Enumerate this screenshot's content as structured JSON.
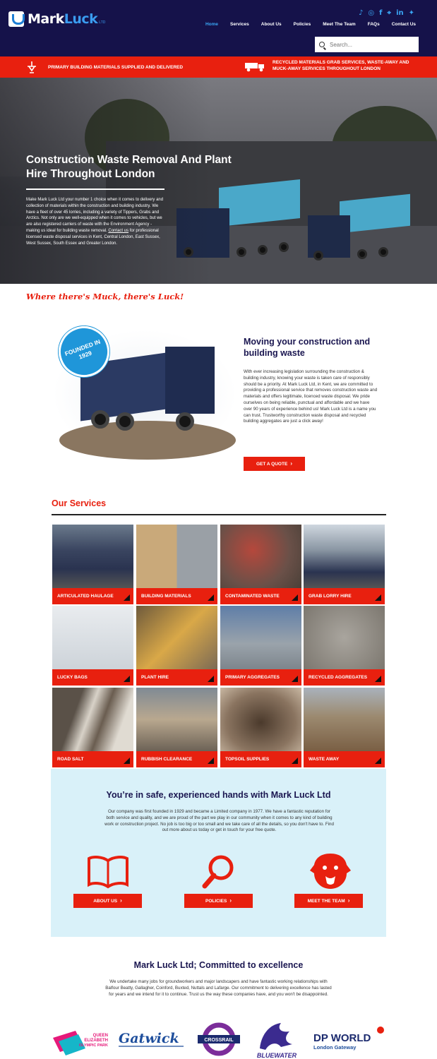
{
  "header": {
    "logo_part1": "Mark",
    "logo_part2": "Luck",
    "logo_ltd": "LTD",
    "social_icons": [
      "tiktok-icon",
      "instagram-icon",
      "facebook-icon",
      "location-icon",
      "linkedin-icon",
      "twitter-icon"
    ],
    "nav": [
      "Home",
      "Services",
      "About Us",
      "Policies",
      "Meet The Team",
      "FAQs",
      "Contact Us"
    ],
    "search_placeholder": "Search..."
  },
  "redbar": {
    "left": "PRIMARY BUILDING MATERIALS SUPPLIED AND DELIVERED",
    "right": "RECYCLED MATERIALS GRAB SERVICES, WASTE-AWAY AND MUCK-AWAY SERVICES THROUGHOUT LONDON"
  },
  "hero": {
    "title": "Construction Waste Removal And Plant Hire Throughout London",
    "text_before_link": "Make Mark Luck Ltd your number 1 choice when it comes to delivery and collection of materials within the construction and building industry. We have a fleet of over 45 lorries, including a variety of Tippers, Grabs and Arctics. Not only are we well-equipped when it comes to vehicles, but we are also registered carriers of waste with the Environment Agency - making us ideal for building waste removal. ",
    "link": "Contact us",
    "text_after_link": " for professional licensed waste disposal services in Kent, Central London, East Sussex, West Sussex, South Essex and Greater London."
  },
  "tagline": "Where there's Muck, there's Luck!",
  "intro": {
    "badge": "FOUNDED IN 1929",
    "heading": "Moving your construction and building waste",
    "text": "With ever increasing legislation surrounding the construction & building industry, knowing your waste is taken care of responsibly should be a priority. At Mark Luck Ltd, in Kent, we are committed to providing a professional service that removes construction waste and materials and offers legitimate, licenced waste disposal. We pride ourselves on being reliable, punctual and affordable and we have over 90 years of experience behind us! Mark Luck Ltd is a name you can trust. Trustworthy construction waste disposal and recycled building aggregates are just a click away!",
    "button": "GET A QUOTE"
  },
  "services": {
    "title": "Our Services",
    "items": [
      {
        "label": "ARTICULATED HAULAGE"
      },
      {
        "label": "BUILDING MATERIALS"
      },
      {
        "label": "CONTAMINATED WASTE"
      },
      {
        "label": "GRAB LORRY HIRE"
      },
      {
        "label": "LUCKY BAGS"
      },
      {
        "label": "PLANT HIRE"
      },
      {
        "label": "PRIMARY AGGREGATES"
      },
      {
        "label": "RECYCLED AGGREGATES"
      },
      {
        "label": "ROAD SALT"
      },
      {
        "label": "RUBBISH CLEARANCE"
      },
      {
        "label": "TOPSOIL SUPPLIES"
      },
      {
        "label": "WASTE AWAY"
      }
    ]
  },
  "safe": {
    "heading": "You’re in safe, experienced hands with Mark Luck Ltd",
    "text": "Our company was first founded in 1929 and became a Limited company in 1977. We have a fantastic reputation for both service and quality, and we are proud of the part we play in our community when it comes to any kind of building work or construction project. No job is too big or too small and we take care of all the details, so you don't have to. Find out more about us today or get in touch for your free quote.",
    "buttons": [
      "ABOUT US",
      "POLICIES",
      "MEET THE TEAM"
    ]
  },
  "committed": {
    "heading": "Mark Luck Ltd; Committed to excellence",
    "text": "We undertake many jobs for groundworkers and major landscapers and have fantastic working relationships with Balfour Beatty, Gallagher, Coinford, Buxted, Nuttals and Lafarge. Our commitment to delivering excellence has lasted for years and we intend for it to continue. Trust us the way these companies have, and you won't be disappointed.",
    "partners": {
      "olympic_line1": "QUEEN",
      "olympic_line2": "ELIZABETH",
      "olympic_line3": "OLYMPIC PARK",
      "gatwick": "Gatwick",
      "crossrail": "CROSSRAIL",
      "bluewater": "BLUEWATER",
      "dpworld": "DP WORLD",
      "dpworld_sub": "London Gateway"
    }
  },
  "colors": {
    "navy": "#15124a",
    "red": "#e8200f",
    "blue": "#3aa6f5",
    "light_blue_panel": "#d9f1f9"
  }
}
